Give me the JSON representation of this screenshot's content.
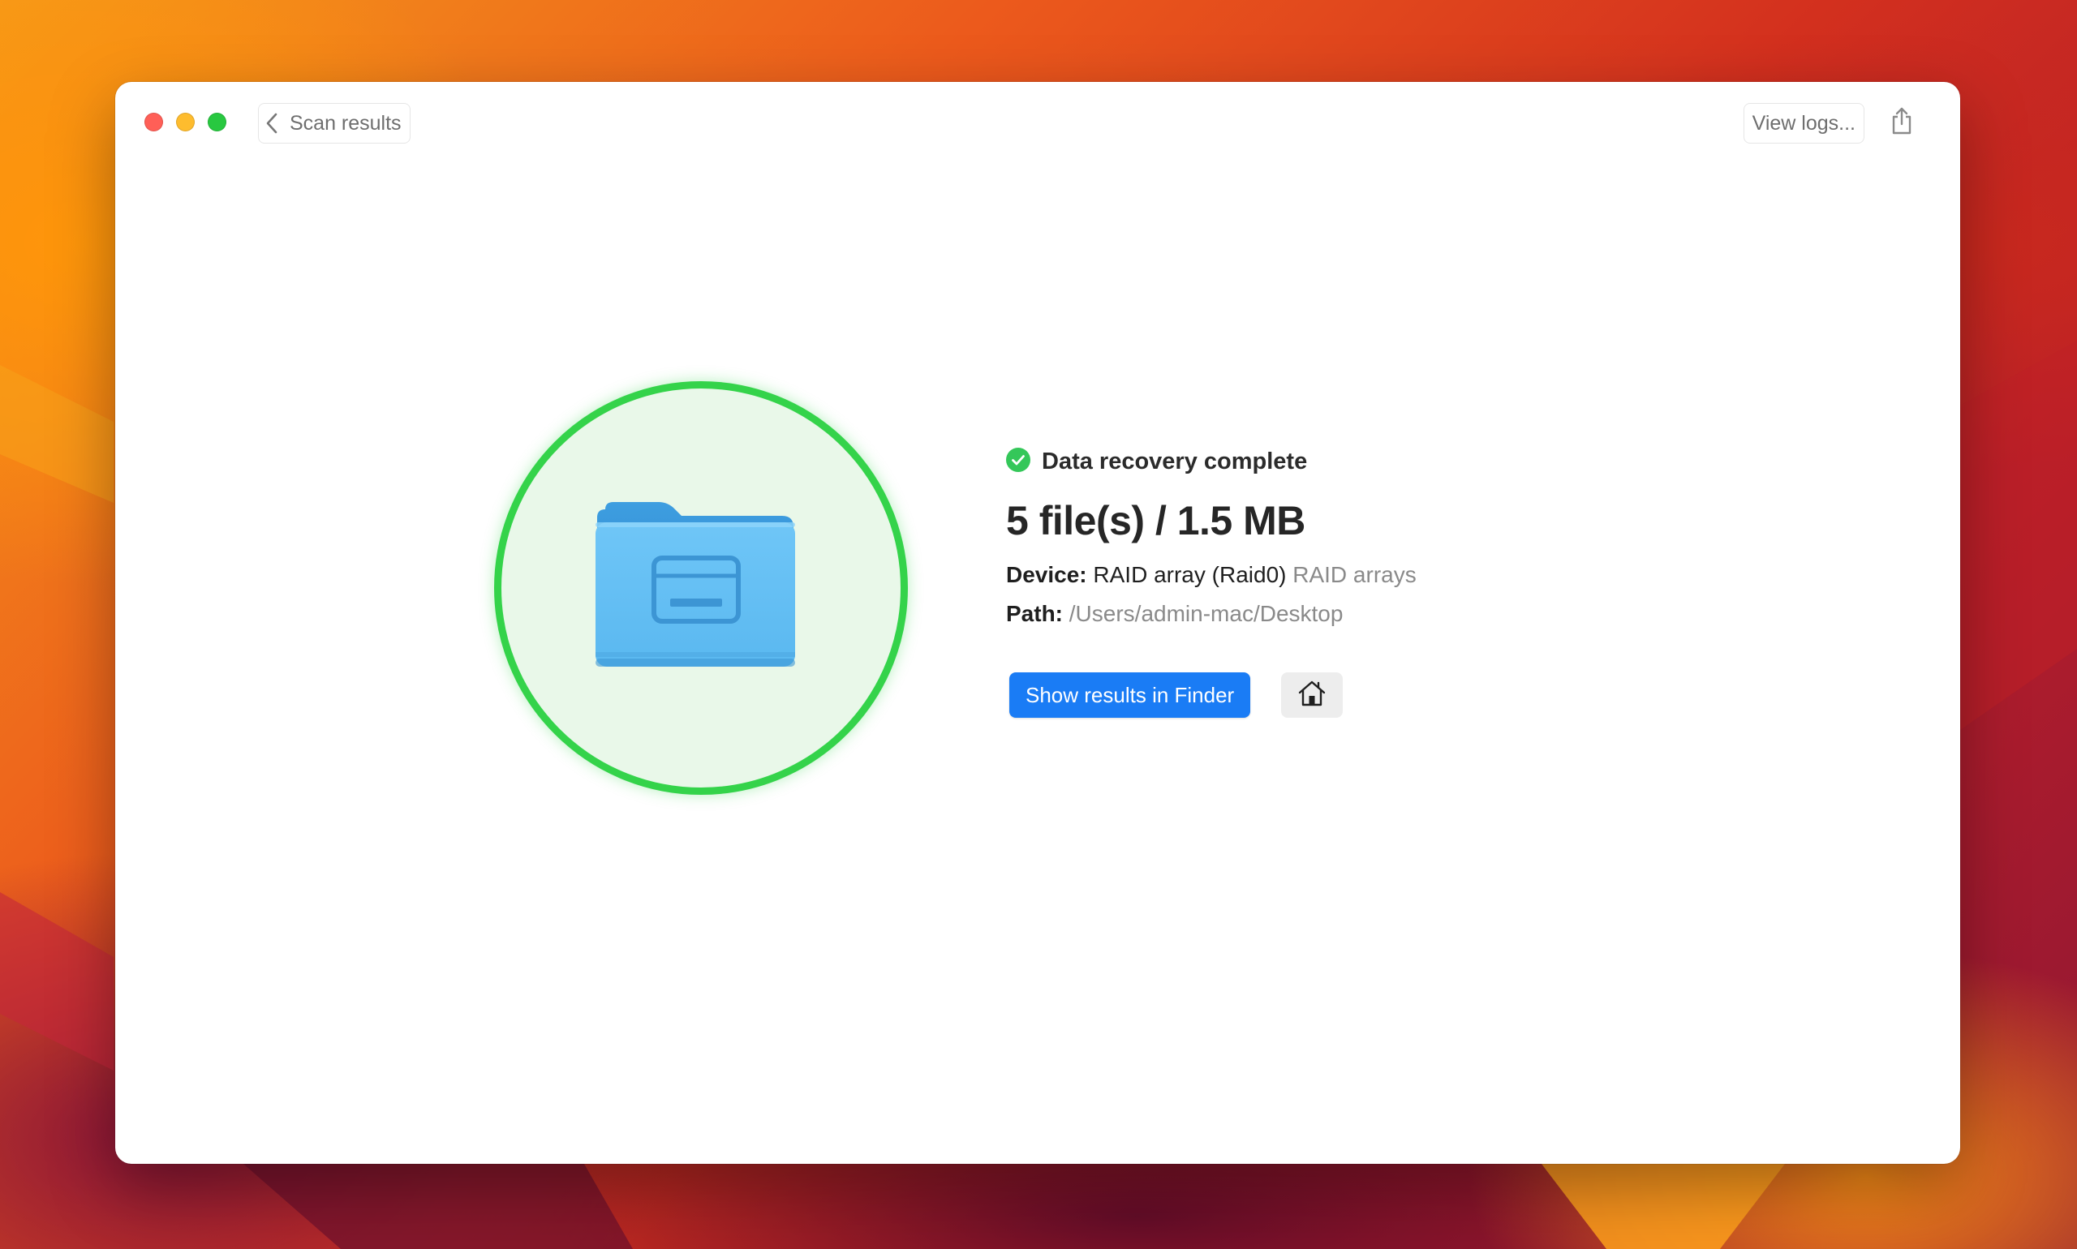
{
  "header": {
    "back_label": "Scan results",
    "logs_label": "View logs..."
  },
  "result": {
    "status": "Data recovery complete",
    "summary": "5 file(s) / 1.5 MB",
    "device_key": "Device:",
    "device_value": "RAID array (Raid0)",
    "device_type": "RAID arrays",
    "path_key": "Path:",
    "path_value": "/Users/admin-mac/Desktop"
  },
  "actions": {
    "primary_label": "Show results in Finder"
  },
  "icons": {
    "back": "chevron-left-icon",
    "share": "share-icon",
    "status": "checkmark-circle-icon",
    "folder": "folder-icon",
    "home": "home-icon"
  },
  "colors": {
    "accent": "#1a7cf5",
    "success": "#34d34a",
    "success_fill": "#e9f8e9"
  }
}
